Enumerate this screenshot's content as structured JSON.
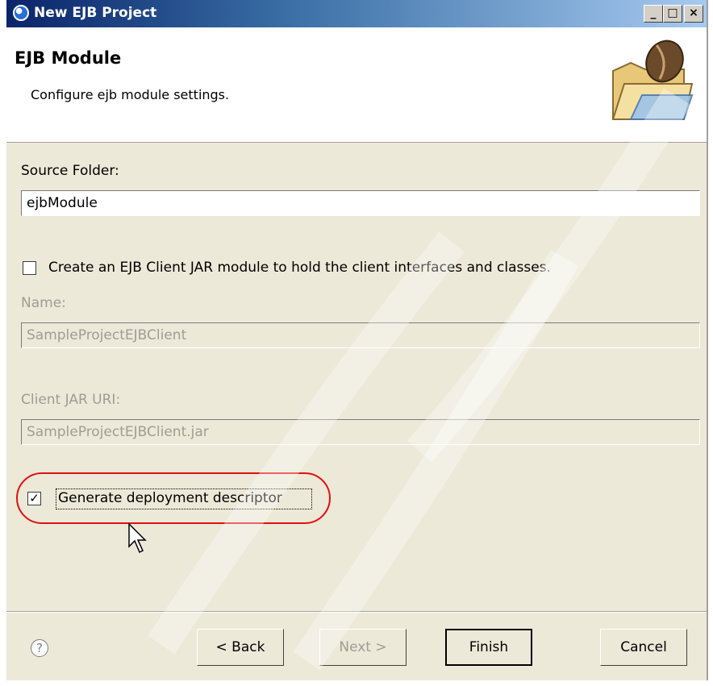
{
  "window": {
    "title": "New EJB Project"
  },
  "titlebar": {
    "minimize": "_",
    "maximize": "□",
    "close": "×"
  },
  "header": {
    "title": "EJB Module",
    "description": "Configure ejb module settings.",
    "icon": "folder-with-bean-icon"
  },
  "form": {
    "source_folder": {
      "label": "Source Folder:",
      "value": "ejbModule"
    },
    "client_jar_checkbox": {
      "label": "Create an EJB Client JAR module to hold the client interfaces and classes.",
      "checked": false
    },
    "name": {
      "label": "Name:",
      "value": "SampleProjectEJBClient",
      "enabled": false
    },
    "client_jar_uri": {
      "label": "Client JAR URI:",
      "value": "SampleProjectEJBClient.jar",
      "enabled": false
    },
    "generate_dd": {
      "label": "Generate deployment descriptor",
      "checked": true,
      "check_glyph": "✓"
    }
  },
  "footer": {
    "help_icon": "?",
    "back": "< Back",
    "next": "Next >",
    "finish": "Finish",
    "cancel": "Cancel"
  },
  "colors": {
    "highlight": "#e01010",
    "title_start": "#0a246a",
    "title_end": "#a6caf0"
  }
}
